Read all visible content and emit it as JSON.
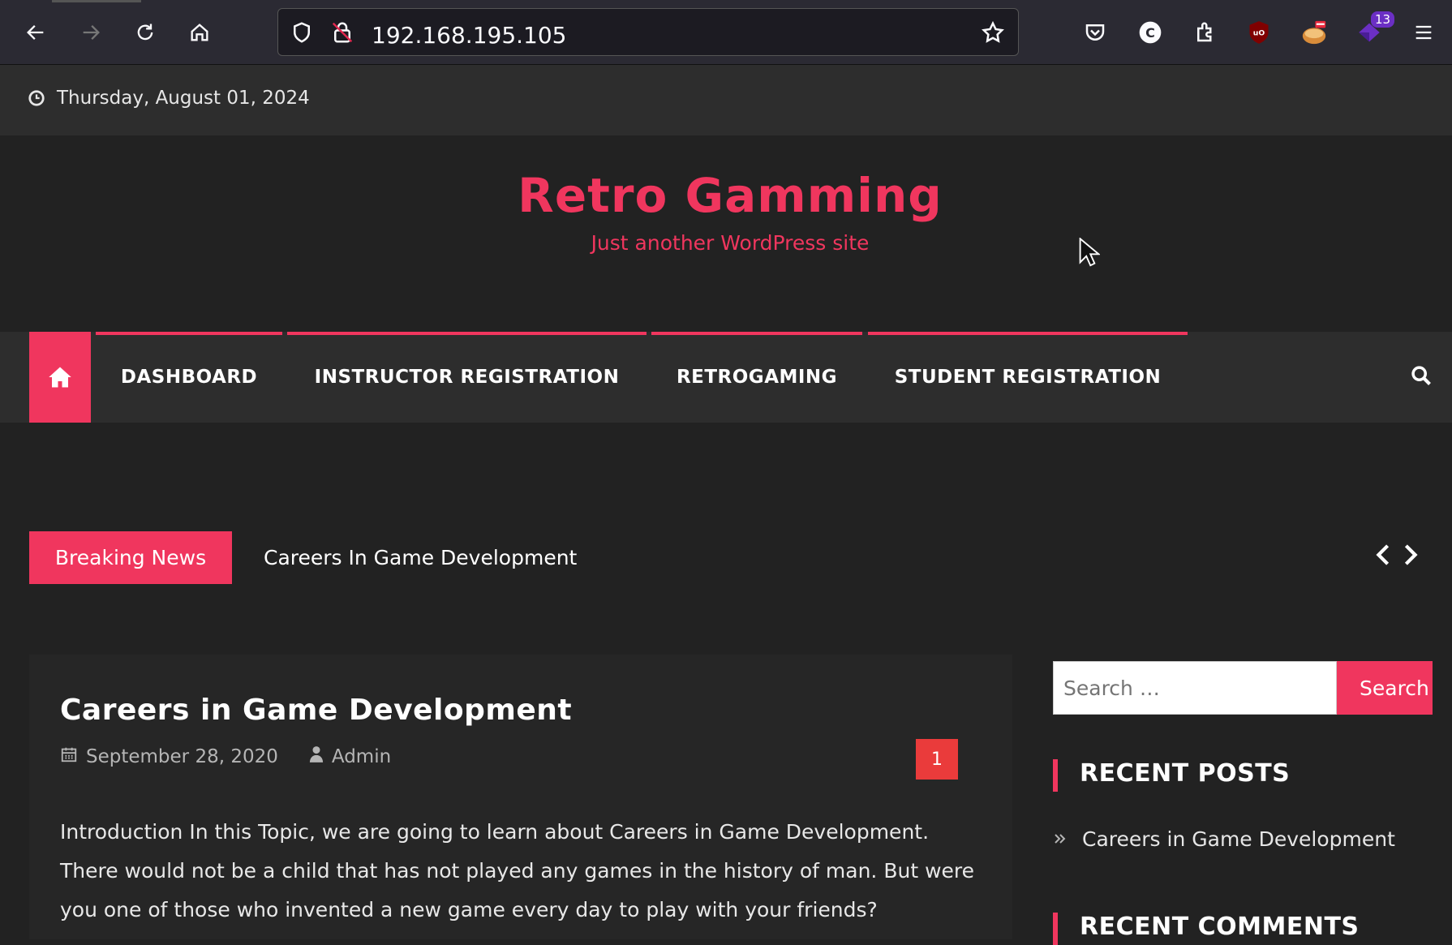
{
  "browser": {
    "url": "192.168.195.105",
    "extension_badge": "13",
    "icons": [
      "back-arrow-icon",
      "forward-arrow-icon",
      "reload-icon",
      "home-icon",
      "shield-icon",
      "insecure-lock-icon",
      "star-icon",
      "pocket-icon",
      "c-extension-icon",
      "extensions-icon",
      "ublock-icon",
      "cookie-extension-icon",
      "purple-extension-icon",
      "hamburger-menu-icon"
    ]
  },
  "topbar": {
    "date": "Thursday, August 01, 2024"
  },
  "header": {
    "title": "Retro Gamming",
    "tagline": "Just another WordPress site"
  },
  "nav": {
    "items": [
      {
        "label": "DASHBOARD"
      },
      {
        "label": "INSTRUCTOR REGISTRATION"
      },
      {
        "label": "RETROGAMING"
      },
      {
        "label": "STUDENT REGISTRATION"
      }
    ]
  },
  "ticker": {
    "label": "Breaking News",
    "headline": "Careers In Game Development"
  },
  "article": {
    "title": "Careers in Game Development",
    "date": "September 28, 2020",
    "author": "Admin",
    "comments": "1",
    "body": "Introduction In this Topic, we are going to learn about Careers in Game Development. There would not be a child that has not played any games in the history of man. But were you one of those who invented a new game every day to play with your friends?"
  },
  "sidebar": {
    "search_placeholder": "Search …",
    "search_button": "Search",
    "recent_posts_title": "RECENT POSTS",
    "recent_posts": [
      "Careers in Game Development"
    ],
    "recent_comments_title": "RECENT COMMENTS"
  },
  "colors": {
    "accent": "#f0365e",
    "background": "#222222",
    "bar": "#2d2d2d",
    "badge": "#ea3b3b"
  }
}
